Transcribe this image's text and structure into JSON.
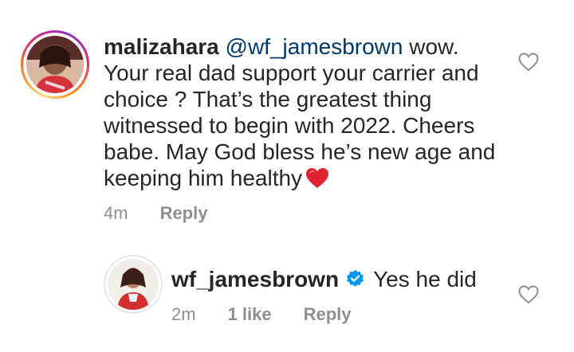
{
  "comment": {
    "username": "malizahara",
    "mention": "@wf_jamesbrown",
    "text": "wow. Your real dad support your carrier and choice ?  That’s the greatest thing witnessed to begin with 2022. Cheers babe. May God bless he’s new age and keeping him healthy",
    "emoji": "red-heart-emoji",
    "time": "4m",
    "reply_label": "Reply",
    "like_icon": "heart-outline-icon"
  },
  "reply": {
    "username": "wf_jamesbrown",
    "verified_icon": "verified-badge-icon",
    "text": "Yes he did",
    "time": "2m",
    "likes": "1 like",
    "reply_label": "Reply",
    "like_icon": "heart-outline-icon"
  },
  "colors": {
    "text": "#262626",
    "mention": "#00376b",
    "meta": "#8e8e8e",
    "verified": "#0095f6",
    "emoji_heart": "#e0232e"
  }
}
